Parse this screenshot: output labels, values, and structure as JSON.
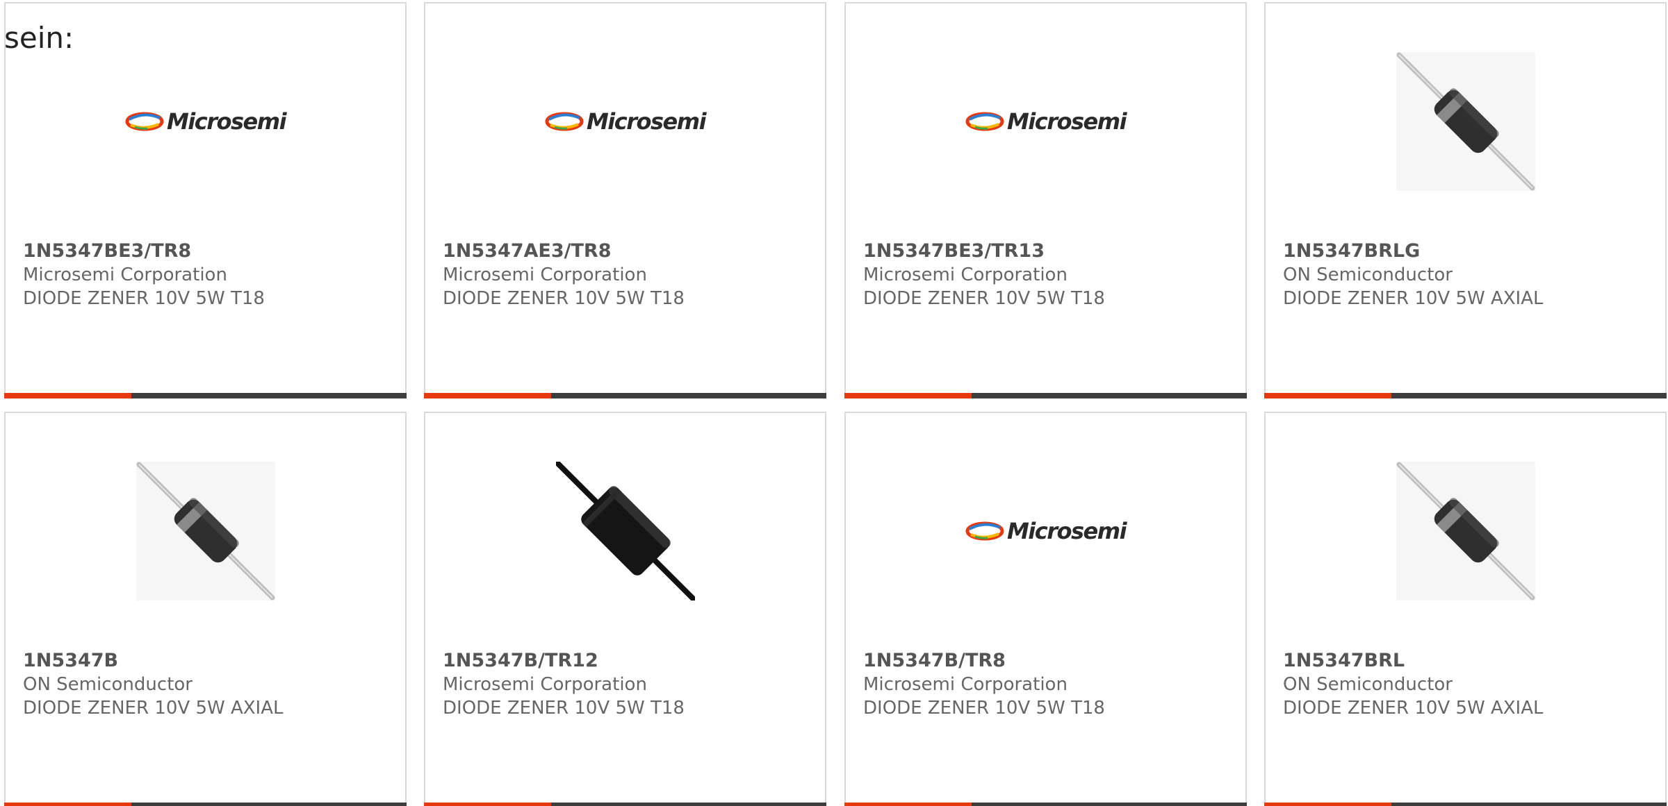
{
  "intro_text": "sein:",
  "colors": {
    "accent": "#e8380d",
    "bar": "#3d3d3d",
    "border": "#d9d9d9"
  },
  "cards": [
    {
      "part_number": "1N5347BE3/TR8",
      "manufacturer": "Microsemi Corporation",
      "description": "DIODE ZENER 10V 5W T18",
      "image": "microsemi-logo",
      "logo_text": "Microsemi"
    },
    {
      "part_number": "1N5347AE3/TR8",
      "manufacturer": "Microsemi Corporation",
      "description": "DIODE ZENER 10V 5W T18",
      "image": "microsemi-logo",
      "logo_text": "Microsemi"
    },
    {
      "part_number": "1N5347BE3/TR13",
      "manufacturer": "Microsemi Corporation",
      "description": "DIODE ZENER 10V 5W T18",
      "image": "microsemi-logo",
      "logo_text": "Microsemi"
    },
    {
      "part_number": "1N5347BRLG",
      "manufacturer": "ON Semiconductor",
      "description": "DIODE ZENER 10V 5W AXIAL",
      "image": "axial-diode-photo-grey"
    },
    {
      "part_number": "1N5347B",
      "manufacturer": "ON Semiconductor",
      "description": "DIODE ZENER 10V 5W AXIAL",
      "image": "axial-diode-photo-grey"
    },
    {
      "part_number": "1N5347B/TR12",
      "manufacturer": "Microsemi Corporation",
      "description": "DIODE ZENER 10V 5W T18",
      "image": "axial-diode-photo-black"
    },
    {
      "part_number": "1N5347B/TR8",
      "manufacturer": "Microsemi Corporation",
      "description": "DIODE ZENER 10V 5W T18",
      "image": "microsemi-logo",
      "logo_text": "Microsemi"
    },
    {
      "part_number": "1N5347BRL",
      "manufacturer": "ON Semiconductor",
      "description": "DIODE ZENER 10V 5W AXIAL",
      "image": "axial-diode-photo-grey"
    }
  ]
}
